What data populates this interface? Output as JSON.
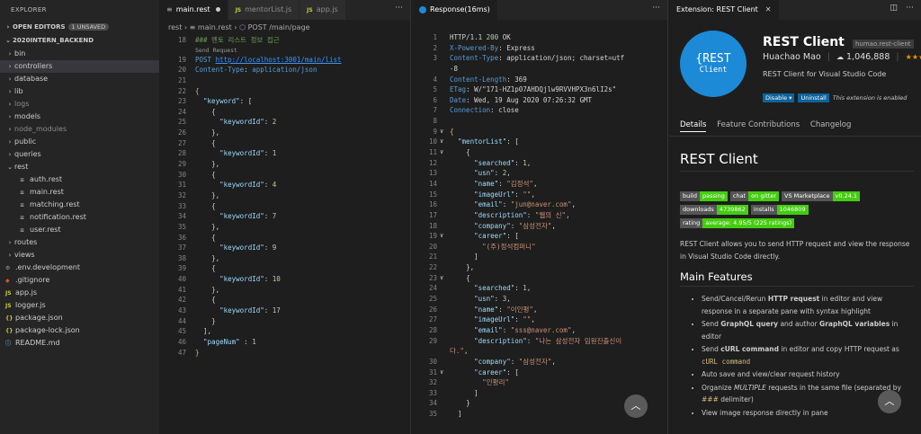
{
  "explorer": {
    "title": "EXPLORER",
    "open_editors": "OPEN EDITORS",
    "unsaved_badge": "1 UNSAVED",
    "project": "2020INTERN_BACKEND",
    "tree": [
      {
        "label": "bin",
        "kind": "folder",
        "indent": 0,
        "dim": false
      },
      {
        "label": "controllers",
        "kind": "folder",
        "indent": 0,
        "dim": false,
        "selected": true
      },
      {
        "label": "database",
        "kind": "folder",
        "indent": 0,
        "dim": false
      },
      {
        "label": "lib",
        "kind": "folder",
        "indent": 0,
        "dim": false
      },
      {
        "label": "logs",
        "kind": "folder",
        "indent": 0,
        "dim": true
      },
      {
        "label": "models",
        "kind": "folder",
        "indent": 0,
        "dim": false
      },
      {
        "label": "node_modules",
        "kind": "folder",
        "indent": 0,
        "dim": true
      },
      {
        "label": "public",
        "kind": "folder",
        "indent": 0,
        "dim": false
      },
      {
        "label": "queries",
        "kind": "folder",
        "indent": 0,
        "dim": false
      },
      {
        "label": "rest",
        "kind": "folder-open",
        "indent": 0,
        "dim": false
      },
      {
        "label": "auth.rest",
        "kind": "rest",
        "indent": 1,
        "dim": false
      },
      {
        "label": "main.rest",
        "kind": "rest",
        "indent": 1,
        "dim": false
      },
      {
        "label": "matching.rest",
        "kind": "rest",
        "indent": 1,
        "dim": false
      },
      {
        "label": "notification.rest",
        "kind": "rest",
        "indent": 1,
        "dim": false
      },
      {
        "label": "user.rest",
        "kind": "rest",
        "indent": 1,
        "dim": false
      },
      {
        "label": "routes",
        "kind": "folder",
        "indent": 0,
        "dim": false
      },
      {
        "label": "views",
        "kind": "folder",
        "indent": 0,
        "dim": false
      },
      {
        "label": ".env.development",
        "kind": "env",
        "indent": 0,
        "dim": false
      },
      {
        "label": ".gitignore",
        "kind": "git",
        "indent": 0,
        "dim": false
      },
      {
        "label": "app.js",
        "kind": "js",
        "indent": 0,
        "dim": false
      },
      {
        "label": "logger.js",
        "kind": "js",
        "indent": 0,
        "dim": false
      },
      {
        "label": "package.json",
        "kind": "json",
        "indent": 0,
        "dim": false
      },
      {
        "label": "package-lock.json",
        "kind": "json",
        "indent": 0,
        "dim": false
      },
      {
        "label": "README.md",
        "kind": "md",
        "indent": 0,
        "dim": false
      }
    ]
  },
  "editor": {
    "tabs": [
      {
        "label": "main.rest",
        "active": true,
        "dirty": true
      },
      {
        "label": "mentorList.js",
        "active": false,
        "js": true
      },
      {
        "label": "app.js",
        "active": false,
        "js": true
      }
    ],
    "breadcrumb": [
      "rest",
      "main.rest",
      "POST /main/page"
    ],
    "send_request": "Send Request",
    "lines": [
      {
        "n": "18",
        "html": "<span class='cmt'>### 멘토 리스트 정보 접근</span>"
      },
      {
        "n": "19",
        "html": "<span class='kw'>POST</span> <span class='url'>http://localhost:3001/main/list</span>"
      },
      {
        "n": "20",
        "html": "<span class='hd'>Content-Type</span><span class='wh'>:</span> <span class='hd'>application/json</span>"
      },
      {
        "n": "21",
        "html": ""
      },
      {
        "n": "22",
        "html": "<span class='yl'>{</span>"
      },
      {
        "n": "23",
        "html": "  <span class='key'>\"keyword\"</span><span class='wh'>: [</span>"
      },
      {
        "n": "24",
        "html": "    <span class='wh'>{</span>"
      },
      {
        "n": "25",
        "html": "      <span class='key'>\"keywordId\"</span><span class='wh'>: </span><span class='num'>2</span>"
      },
      {
        "n": "26",
        "html": "    <span class='wh'>},</span>"
      },
      {
        "n": "27",
        "html": "    <span class='wh'>{</span>"
      },
      {
        "n": "28",
        "html": "      <span class='key'>\"keywordId\"</span><span class='wh'>: </span><span class='num'>1</span>"
      },
      {
        "n": "29",
        "html": "    <span class='wh'>},</span>"
      },
      {
        "n": "30",
        "html": "    <span class='wh'>{</span>"
      },
      {
        "n": "31",
        "html": "      <span class='key'>\"keywordId\"</span><span class='wh'>: </span><span class='num'>4</span>"
      },
      {
        "n": "32",
        "html": "    <span class='wh'>},</span>"
      },
      {
        "n": "33",
        "html": "    <span class='wh'>{</span>"
      },
      {
        "n": "34",
        "html": "      <span class='key'>\"keywordId\"</span><span class='wh'>: </span><span class='num'>7</span>"
      },
      {
        "n": "35",
        "html": "    <span class='wh'>},</span>"
      },
      {
        "n": "36",
        "html": "    <span class='wh'>{</span>"
      },
      {
        "n": "37",
        "html": "      <span class='key'>\"keywordId\"</span><span class='wh'>: </span><span class='num'>9</span>"
      },
      {
        "n": "38",
        "html": "    <span class='wh'>},</span>"
      },
      {
        "n": "39",
        "html": "    <span class='wh'>{</span>"
      },
      {
        "n": "40",
        "html": "      <span class='key'>\"keywordId\"</span><span class='wh'>: </span><span class='num'>10</span>"
      },
      {
        "n": "41",
        "html": "    <span class='wh'>},</span>"
      },
      {
        "n": "42",
        "html": "    <span class='wh'>{</span>"
      },
      {
        "n": "43",
        "html": "      <span class='key'>\"keywordId\"</span><span class='wh'>: </span><span class='num'>17</span>"
      },
      {
        "n": "44",
        "html": "    <span class='wh'>}</span>"
      },
      {
        "n": "45",
        "html": "  <span class='wh'>],</span>"
      },
      {
        "n": "46",
        "html": "  <span class='key'>\"pageNum\"</span><span class='wh'> : </span><span class='num'>1</span>"
      },
      {
        "n": "47",
        "html": "<span class='yl'>}</span>"
      }
    ]
  },
  "response": {
    "tab": "Response(16ms)",
    "lines": [
      {
        "n": "1",
        "f": "",
        "html": "<span class='wh'>HTTP/1.1 </span><span class='num'>200</span><span class='wh'> OK</span>"
      },
      {
        "n": "2",
        "f": "",
        "html": "<span class='hd'>X-Powered-By</span><span class='wh'>: Express</span>"
      },
      {
        "n": "3",
        "f": "",
        "html": "<span class='hd'>Content-Type</span><span class='wh'>: application/json; charset=utf</span>"
      },
      {
        "n": "",
        "f": "",
        "html": "<span class='wh'>-8</span>"
      },
      {
        "n": "4",
        "f": "",
        "html": "<span class='hd'>Content-Length</span><span class='wh'>: 369</span>"
      },
      {
        "n": "5",
        "f": "",
        "html": "<span class='hd'>ETag</span><span class='wh'>: W/\"171-HZ1p07AHDQjlw9RVVHPX3n6lI2s\"</span>"
      },
      {
        "n": "6",
        "f": "",
        "html": "<span class='hd'>Date</span><span class='wh'>: Wed, 19 Aug 2020 07:26:32 GMT</span>"
      },
      {
        "n": "7",
        "f": "",
        "html": "<span class='hd'>Connection</span><span class='wh'>: close</span>"
      },
      {
        "n": "8",
        "f": "",
        "html": ""
      },
      {
        "n": "9",
        "f": "∨",
        "html": "<span class='yl'>{</span>"
      },
      {
        "n": "10",
        "f": "∨",
        "html": "  <span class='key'>\"mentorList\"</span><span class='wh'>: [</span>"
      },
      {
        "n": "11",
        "f": "∨",
        "html": "    <span class='wh'>{</span>"
      },
      {
        "n": "12",
        "f": "",
        "html": "      <span class='key'>\"searched\"</span><span class='wh'>: </span><span class='num'>1</span><span class='wh'>,</span>"
      },
      {
        "n": "13",
        "f": "",
        "html": "      <span class='key'>\"usn\"</span><span class='wh'>: </span><span class='num'>2</span><span class='wh'>,</span>"
      },
      {
        "n": "14",
        "f": "",
        "html": "      <span class='key'>\"name\"</span><span class='wh'>: </span><span class='str'>\"김정석\"</span><span class='wh'>,</span>"
      },
      {
        "n": "15",
        "f": "",
        "html": "      <span class='key'>\"imageUrl\"</span><span class='wh'>: </span><span class='str'>\"\"</span><span class='wh'>,</span>"
      },
      {
        "n": "16",
        "f": "",
        "html": "      <span class='key'>\"email\"</span><span class='wh'>: </span><span class='str'>\"jun@naver.com\"</span><span class='wh'>,</span>"
      },
      {
        "n": "17",
        "f": "",
        "html": "      <span class='key'>\"description\"</span><span class='wh'>: </span><span class='str'>\"웹의 신\"</span><span class='wh'>,</span>"
      },
      {
        "n": "18",
        "f": "",
        "html": "      <span class='key'>\"company\"</span><span class='wh'>: </span><span class='str'>\"삼성전자\"</span><span class='wh'>,</span>"
      },
      {
        "n": "19",
        "f": "∨",
        "html": "      <span class='key'>\"career\"</span><span class='wh'>: [</span>"
      },
      {
        "n": "20",
        "f": "",
        "html": "        <span class='str'>\"(주)정석컴퍼니\"</span>"
      },
      {
        "n": "21",
        "f": "",
        "html": "      <span class='wh'>]</span>"
      },
      {
        "n": "22",
        "f": "",
        "html": "    <span class='wh'>},</span>"
      },
      {
        "n": "23",
        "f": "∨",
        "html": "    <span class='wh'>{</span>"
      },
      {
        "n": "24",
        "f": "",
        "html": "      <span class='key'>\"searched\"</span><span class='wh'>: </span><span class='num'>1</span><span class='wh'>,</span>"
      },
      {
        "n": "25",
        "f": "",
        "html": "      <span class='key'>\"usn\"</span><span class='wh'>: </span><span class='num'>3</span><span class='wh'>,</span>"
      },
      {
        "n": "26",
        "f": "",
        "html": "      <span class='key'>\"name\"</span><span class='wh'>: </span><span class='str'>\"이인평\"</span><span class='wh'>,</span>"
      },
      {
        "n": "27",
        "f": "",
        "html": "      <span class='key'>\"imageUrl\"</span><span class='wh'>: </span><span class='str'>\"\"</span><span class='wh'>,</span>"
      },
      {
        "n": "28",
        "f": "",
        "html": "      <span class='key'>\"email\"</span><span class='wh'>: </span><span class='str'>\"sss@naver.com\"</span><span class='wh'>,</span>"
      },
      {
        "n": "29",
        "f": "",
        "html": "      <span class='key'>\"description\"</span><span class='wh'>: </span><span class='str'>\"나는 삼성전자 임원진출신이</span>"
      },
      {
        "n": "",
        "f": "",
        "html": "<span class='str'>다.\"</span><span class='wh'>,</span>"
      },
      {
        "n": "30",
        "f": "",
        "html": "      <span class='key'>\"company\"</span><span class='wh'>: </span><span class='str'>\"삼성전자\"</span><span class='wh'>,</span>"
      },
      {
        "n": "31",
        "f": "∨",
        "html": "      <span class='key'>\"career\"</span><span class='wh'>: [</span>"
      },
      {
        "n": "32",
        "f": "",
        "html": "        <span class='str'>\"인평리\"</span>"
      },
      {
        "n": "33",
        "f": "",
        "html": "      <span class='wh'>]</span>"
      },
      {
        "n": "34",
        "f": "",
        "html": "    <span class='wh'>}</span>"
      },
      {
        "n": "35",
        "f": "",
        "html": "  <span class='wh'>]</span>"
      }
    ]
  },
  "extension": {
    "tab": "Extension: REST Client",
    "name": "REST Client",
    "id": "humao.rest-client",
    "publisher": "Huachao Mao",
    "installs": "1,046,888",
    "description": "REST Client for Visual Studio Code",
    "disable": "Disable ▾",
    "uninstall": "Uninstall",
    "enabled_note": "This extension is enabled",
    "logo_l1": "{REST",
    "logo_l2": "Client",
    "tabs": [
      "Details",
      "Feature Contributions",
      "Changelog"
    ],
    "heading": "REST Client",
    "badges": [
      [
        {
          "a": "build",
          "b": "passing",
          "c": "gr"
        },
        {
          "a": "chat",
          "b": "on gitter",
          "c": "gr"
        },
        {
          "a": "VS Marketplace",
          "b": "v0.24.1",
          "c": "gr"
        }
      ],
      [
        {
          "a": "downloads",
          "b": "4739862",
          "c": "gr"
        },
        {
          "a": "installs",
          "b": "1046809",
          "c": "gr"
        }
      ],
      [
        {
          "a": "rating",
          "b": "average: 4.95/5 (225 ratings)",
          "c": "gr"
        }
      ]
    ],
    "intro": "REST Client allows you to send HTTP request and view the response in Visual Studio Code directly.",
    "main_features": "Main Features",
    "features": [
      "Send/Cancel/Rerun <b>HTTP request</b> in editor and view response in a separate pane with syntax highlight",
      "Send <b>GraphQL query</b> and author <b>GraphQL variables</b> in editor",
      "Send <b>cURL command</b> in editor and copy HTTP request as <span style='color:#d7ba7d;font-family:DejaVu Sans Mono,monospace'>cURL command</span>",
      "Auto save and view/clear request history",
      "Organize <i>MULTIPLE</i> requests in the same file (separated by <span style='color:#d7ba7d'>###</span> delimiter)",
      "View image response directly in pane"
    ]
  }
}
